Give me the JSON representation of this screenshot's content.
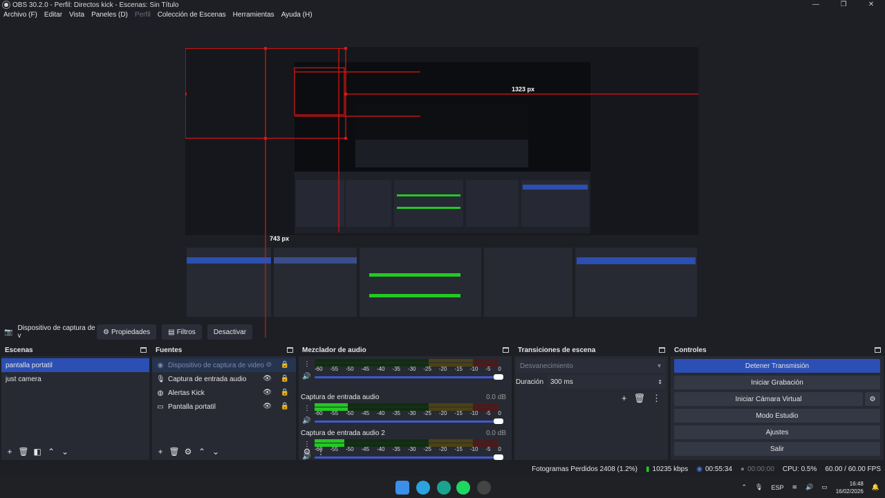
{
  "window": {
    "title": "OBS 30.2.0 - Perfil: Directos kick - Escenas: Sin Título",
    "controls": [
      "—",
      "❐",
      "✕"
    ]
  },
  "menu": [
    "Archivo (F)",
    "Editar",
    "Vista",
    "Paneles (D)",
    "Perfil",
    "Colección de Escenas",
    "Herramientas",
    "Ayuda (H)"
  ],
  "preview": {
    "labels": {
      "width": "1323 px",
      "height": "743 px"
    }
  },
  "source_toolbar": {
    "source_name": "Dispositivo de captura de v",
    "properties": "Propiedades",
    "filters": "Filtros",
    "deactivate": "Desactivar"
  },
  "scenes": {
    "title": "Escenas",
    "items": [
      "pantalla portatil",
      "just camera"
    ],
    "selected": 0
  },
  "sources": {
    "title": "Fuentes",
    "items": [
      {
        "icon": "camera-icon",
        "label": "Dispositivo de captura de video",
        "dim": true
      },
      {
        "icon": "mic-icon",
        "label": "Captura de entrada audio",
        "dim": false
      },
      {
        "icon": "browser-icon",
        "label": "Alertas Kick",
        "dim": false
      },
      {
        "icon": "monitor-icon",
        "label": "Pantalla portatil",
        "dim": false
      }
    ]
  },
  "mixer": {
    "title": "Mezclador de audio",
    "scale": [
      "-60",
      "-55",
      "-50",
      "-45",
      "-40",
      "-35",
      "-30",
      "-25",
      "-20",
      "-15",
      "-10",
      "-5",
      "0"
    ],
    "channels": [
      {
        "label": "",
        "db": "",
        "level": 0.0
      },
      {
        "label": "Captura de entrada audio",
        "db": "0.0 dB",
        "level": 0.18
      },
      {
        "label": "Captura de entrada audio 2",
        "db": "0.0 dB",
        "level": 0.16
      }
    ]
  },
  "transitions": {
    "title": "Transiciones de escena",
    "selected": "Desvanecimiento",
    "duration_label": "Duración",
    "duration_value": "300 ms"
  },
  "controls": {
    "title": "Controles",
    "buttons": [
      "Detener Transmisión",
      "Iniciar Grabación",
      "Iniciar Cámara Virtual",
      "Modo Estudio",
      "Ajustes",
      "Salir"
    ]
  },
  "status": {
    "dropped": "Fotogramas Perdidos 2408 (1.2%)",
    "bitrate": "10235 kbps",
    "stream_time": "00:55:34",
    "rec_time": "00:00:00",
    "cpu": "CPU: 0.5%",
    "fps": "60.00 / 60.00 FPS"
  },
  "taskbar": {
    "lang": "ESP",
    "time": "16:48",
    "date": "16/02/2026"
  },
  "colors": {
    "accent": "#2b4fb3",
    "bg": "#1d1f25",
    "panel": "#272a33"
  }
}
